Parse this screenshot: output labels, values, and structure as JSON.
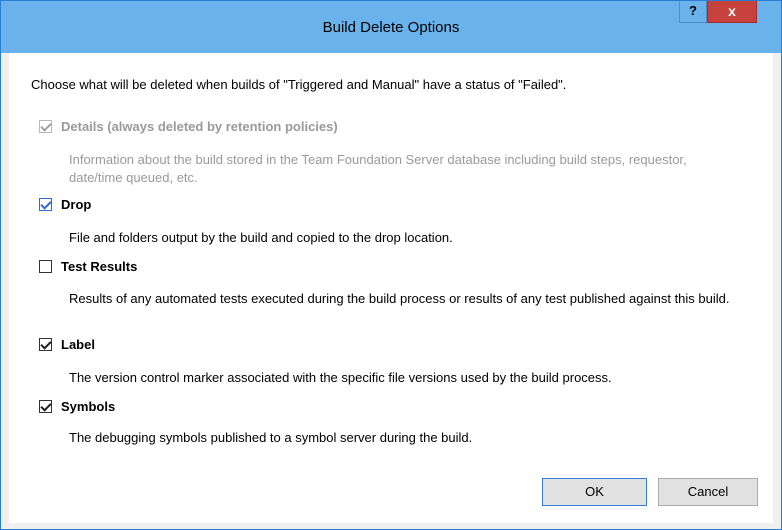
{
  "dialog": {
    "title": "Build Delete Options",
    "help_label": "?",
    "close_label": "x",
    "intro": "Choose what will be deleted when builds of \"Triggered and Manual\" have a status of \"Failed\"."
  },
  "options": [
    {
      "label": "Details (always deleted by retention policies)",
      "checked": true,
      "enabled": false,
      "description": "Information about the build stored in the Team Foundation Server database including build steps, requestor, date/time queued, etc."
    },
    {
      "label": "Drop",
      "checked": true,
      "enabled": true,
      "description": "File and folders output by the  build and copied to the drop location."
    },
    {
      "label": "Test Results",
      "checked": false,
      "enabled": true,
      "description": "Results of any automated tests executed during the build process or results of any test published against this build."
    },
    {
      "label": "Label",
      "checked": true,
      "enabled": true,
      "description": "The version control marker associated with the specific file versions used by the build process."
    },
    {
      "label": "Symbols",
      "checked": true,
      "enabled": true,
      "description": "The debugging symbols published to a symbol server during the build."
    }
  ],
  "buttons": {
    "ok": "OK",
    "cancel": "Cancel"
  },
  "colors": {
    "titlebar": "#69b2ec",
    "close": "#c7413d",
    "accent": "#2e6bd1"
  }
}
